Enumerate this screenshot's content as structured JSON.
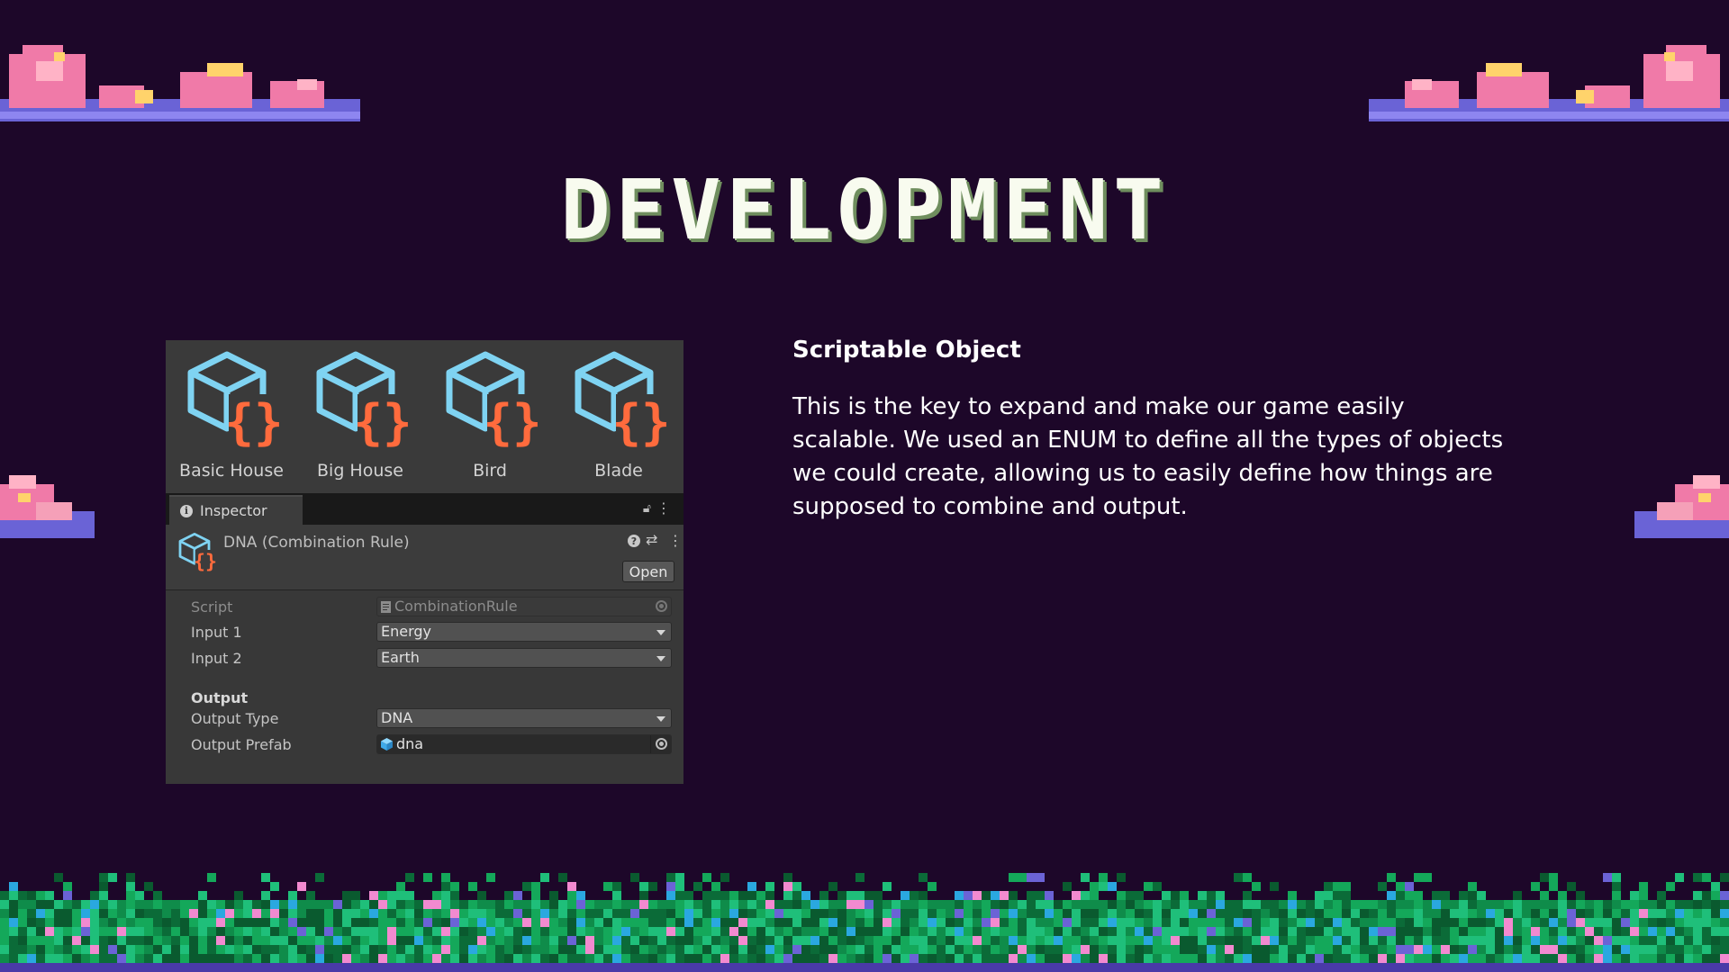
{
  "title": "DEVELOPMENT",
  "assets": [
    {
      "label": "Basic House"
    },
    {
      "label": "Big House"
    },
    {
      "label": "Bird"
    },
    {
      "label": "Blade"
    }
  ],
  "inspector": {
    "tab_label": "Inspector",
    "object_title": "DNA (Combination Rule)",
    "open_label": "Open",
    "fields": {
      "script": {
        "label": "Script",
        "value": "CombinationRule"
      },
      "input1": {
        "label": "Input 1",
        "value": "Energy"
      },
      "input2": {
        "label": "Input 2",
        "value": "Earth"
      },
      "output_section": "Output",
      "output_type": {
        "label": "Output Type",
        "value": "DNA"
      },
      "output_prefab": {
        "label": "Output Prefab",
        "value": "dna"
      }
    }
  },
  "description": {
    "heading": "Scriptable Object",
    "body": "This is the key to expand and make our game easily scalable. We used an ENUM to define all the types of objects we could create, allowing us to easily define how things are supposed to combine and output."
  },
  "colors": {
    "background": "#1d0729",
    "cube_blue": "#7fd3f2",
    "braces_orange": "#ff6b3d",
    "cloud_pink": "#f07aa8",
    "cloud_purple": "#6a63d6",
    "grass_green": "#0f8c4a"
  },
  "icons": {
    "asset": "scriptable-object-icon",
    "info": "info-icon",
    "lock": "lock-icon",
    "menu": "kebab-menu-icon",
    "help": "help-icon",
    "preset": "preset-sliders-icon",
    "picker": "object-picker-icon"
  }
}
